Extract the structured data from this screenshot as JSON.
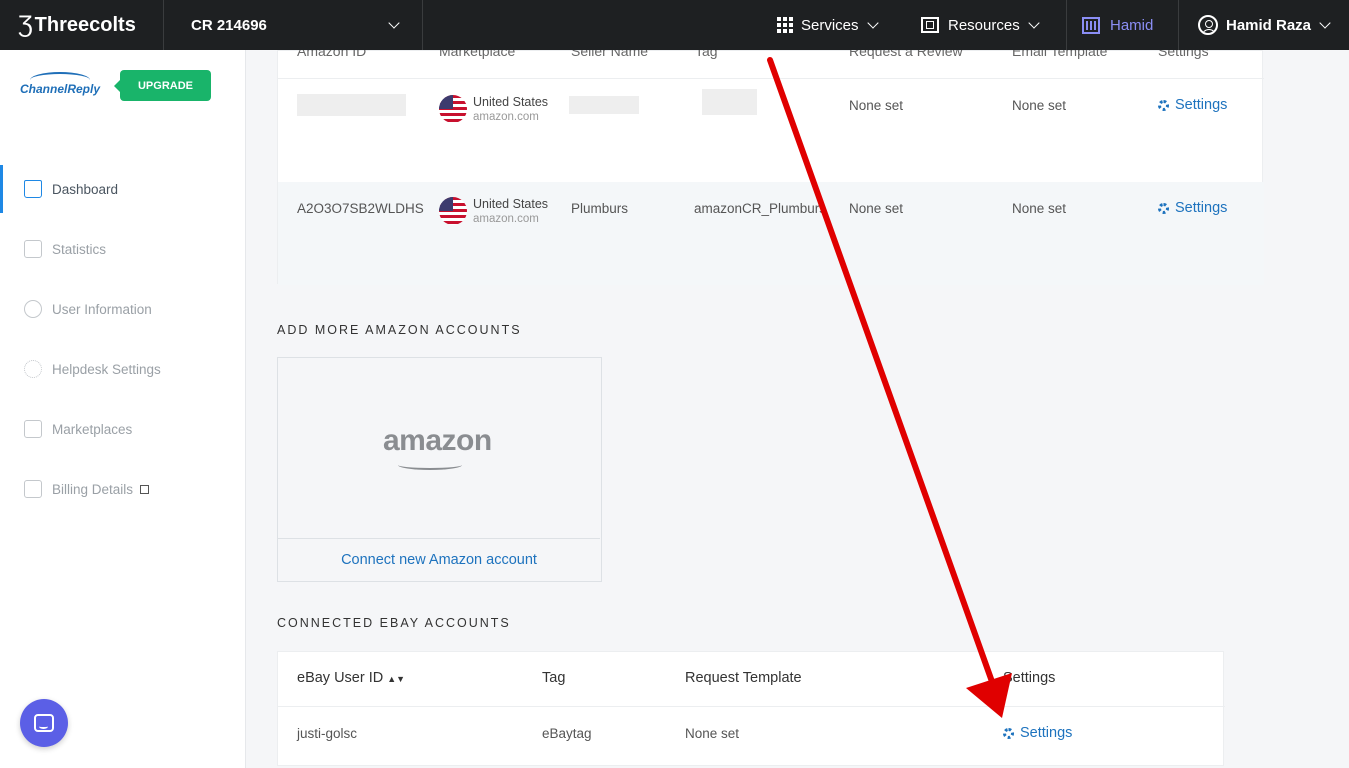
{
  "topbar": {
    "brand": "Threecolts",
    "account": "CR 214696",
    "services": "Services",
    "resources": "Resources",
    "workspace": "Hamid",
    "user_name": "Hamid Raza"
  },
  "sidebar": {
    "logo_channel": "Channel",
    "logo_reply": "Reply",
    "upgrade": "UPGRADE",
    "items": [
      {
        "label": "Dashboard",
        "icon": "home-icon"
      },
      {
        "label": "Statistics",
        "icon": "clipboard-chart-icon"
      },
      {
        "label": "User Information",
        "icon": "user-icon"
      },
      {
        "label": "Helpdesk Settings",
        "icon": "gear-icon"
      },
      {
        "label": "Marketplaces",
        "icon": "store-icon"
      },
      {
        "label": "Billing Details",
        "icon": "receipt-icon"
      }
    ]
  },
  "amazon_table": {
    "headers": [
      "Amazon ID",
      "Marketplace",
      "Seller Name",
      "Tag",
      "Request a Review",
      "Email Template",
      "Settings"
    ],
    "rows": [
      {
        "amazon_id": "",
        "country": "United States",
        "domain": "amazon.com",
        "seller": "",
        "tag": "",
        "review": "None set",
        "template": "None set",
        "settings": "Settings"
      },
      {
        "amazon_id": "A2O3O7SB2WLDHS",
        "country": "United States",
        "domain": "amazon.com",
        "seller": "Plumburs",
        "tag": "amazonCR_Plumburs",
        "review": "None set",
        "template": "None set",
        "settings": "Settings"
      }
    ]
  },
  "add_amazon": {
    "title": "ADD MORE AMAZON ACCOUNTS",
    "logo_text": "amazon",
    "connect": "Connect new Amazon account"
  },
  "ebay": {
    "title": "CONNECTED EBAY ACCOUNTS",
    "headers": [
      "eBay User ID",
      "Tag",
      "Request Template",
      "Settings"
    ],
    "row": {
      "user_id": "justi-golsc",
      "tag": "eBaytag",
      "template": "None set",
      "settings": "Settings"
    }
  },
  "colors": {
    "accent": "#1e73be",
    "topbar": "#1e2022",
    "upgrade": "#19b46a",
    "arrow": "#e00000"
  }
}
